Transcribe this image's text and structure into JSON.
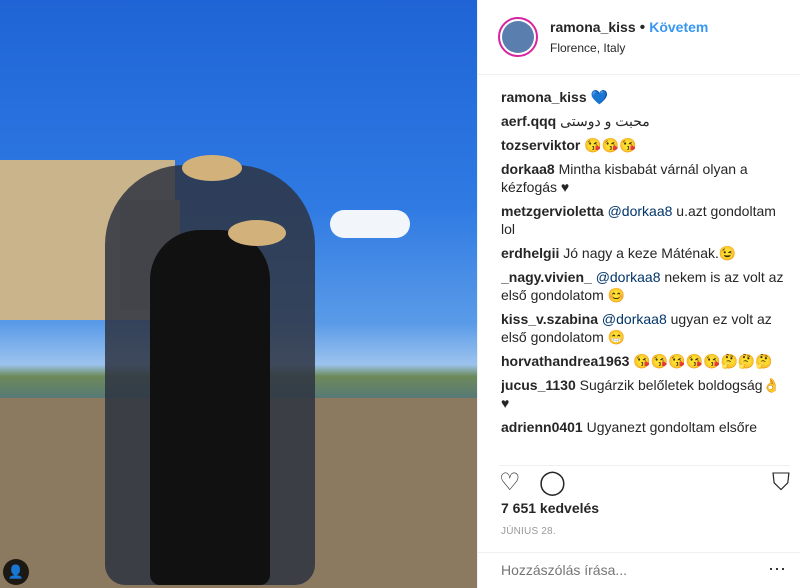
{
  "post": {
    "username": "ramona_kiss",
    "follow_label": "Követem",
    "location": "Florence, Italy",
    "likes": "7 651 kedvelés",
    "date": "JÚNIUS 28.",
    "add_comment_placeholder": "Hozzászólás írása..."
  },
  "caption": {
    "user": "ramona_kiss",
    "text": "💙"
  },
  "comments": [
    {
      "user": "aerf.qqq",
      "text": "محبت و دوستی"
    },
    {
      "user": "tozserviktor",
      "text": "😘😘😘"
    },
    {
      "user": "dorkaa8",
      "text": "Mintha kisbabát várnál olyan a kézfogás ♥"
    },
    {
      "user": "metzgervioletta",
      "mention": "@dorkaa8",
      "text": " u.azt gondoltam lol"
    },
    {
      "user": "erdhelgii",
      "text": "Jó nagy a keze Máténak.😉"
    },
    {
      "user": "_nagy.vivien_",
      "mention": "@dorkaa8",
      "text": " nekem is az volt az első gondolatom 😊"
    },
    {
      "user": "kiss_v.szabina",
      "mention": "@dorkaa8",
      "text": " ugyan ez volt az első gondolatom 😁"
    },
    {
      "user": "horvathandrea1963",
      "text": "😘😘😘😘😘🤔🤔🤔"
    },
    {
      "user": "jucus_1130",
      "text": "Sugárzik belőletek boldogság👌♥"
    },
    {
      "user": "adrienn0401",
      "text": "Ugyanezt gondoltam elsőre"
    }
  ],
  "icons": {
    "like": "heart-icon",
    "comment": "comment-icon",
    "save": "bookmark-icon",
    "more": "more-icon",
    "tag": "user-tag-icon"
  }
}
